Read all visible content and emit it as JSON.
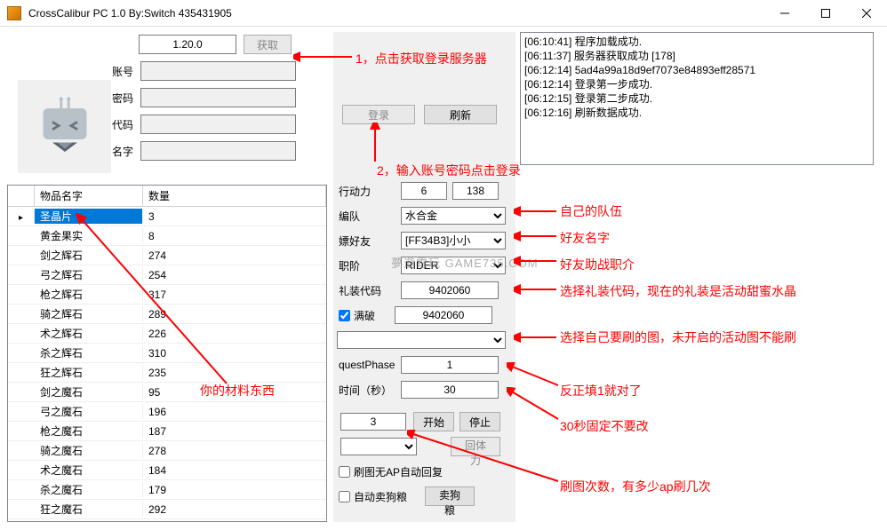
{
  "window": {
    "title": "CrossCalibur PC 1.0 By:Switch 435431905"
  },
  "top": {
    "version": "1.20.0",
    "fetch_btn": "获取",
    "account_lbl": "账号",
    "password_lbl": "密码",
    "code_lbl": "代码",
    "name_lbl": "名字",
    "login_btn": "登录",
    "refresh_btn": "刷新"
  },
  "grid": {
    "col_name": "物品名字",
    "col_qty": "数量",
    "rows": [
      {
        "name": "圣晶片",
        "qty": "3"
      },
      {
        "name": "黄金果实",
        "qty": "8"
      },
      {
        "name": "剑之辉石",
        "qty": "274"
      },
      {
        "name": "弓之辉石",
        "qty": "254"
      },
      {
        "name": "枪之辉石",
        "qty": "317"
      },
      {
        "name": "骑之辉石",
        "qty": "289"
      },
      {
        "name": "术之辉石",
        "qty": "226"
      },
      {
        "name": "杀之辉石",
        "qty": "310"
      },
      {
        "name": "狂之辉石",
        "qty": "235"
      },
      {
        "name": "剑之魔石",
        "qty": "95"
      },
      {
        "name": "弓之魔石",
        "qty": "196"
      },
      {
        "name": "枪之魔石",
        "qty": "187"
      },
      {
        "name": "骑之魔石",
        "qty": "278"
      },
      {
        "name": "术之魔石",
        "qty": "184"
      },
      {
        "name": "杀之魔石",
        "qty": "179"
      },
      {
        "name": "狂之魔石",
        "qty": "292"
      }
    ]
  },
  "mid": {
    "action_lbl": "行动力",
    "action_v1": "6",
    "action_v2": "138",
    "team_lbl": "编队",
    "team_val": "水合金",
    "friend_lbl": "嫖好友",
    "friend_val": "[FF34B3]小小",
    "class_lbl": "职阶",
    "class_val": "RIDER",
    "ce_lbl": "礼装代码",
    "ce_val": "9402060",
    "mlb_lbl": "满破",
    "mlb_val": "9402060",
    "phase_lbl": "questPhase",
    "phase_val": "1",
    "time_lbl": "时间（秒）",
    "time_val": "30",
    "count_val": "3",
    "start_btn": "开始",
    "stop_btn": "停止",
    "recover_btn": "回体力",
    "auto_ap_lbl": "刷图无AP自动回复",
    "auto_sell_lbl": "自动卖狗粮",
    "sell_btn": "卖狗粮"
  },
  "log": [
    "[06:10:41] 程序加载成功.",
    "[06:11:37] 服务器获取成功 [178]",
    "[06:12:14] 5ad4a99a18d9ef7073e84893eff28571",
    "[06:12:14] 登录第一步成功.",
    "[06:12:15] 登录第二步成功.",
    "[06:12:16] 刷新数据成功."
  ],
  "annotations": {
    "a1": "1，点击获取登录服务器",
    "a2": "2，输入账号密码点击登录",
    "a3": "你的材料东西",
    "b1": "自己的队伍",
    "b2": "好友名字",
    "b3": "好友助战职介",
    "b4": "选择礼装代码，现在的礼装是活动甜蜜水晶",
    "b5": "选择自己要刷的图，未开启的活动图不能刷",
    "b6": "反正填1就对了",
    "b7": "30秒固定不要改",
    "b8": "刷图次数，有多少ap刷几次"
  },
  "watermark": "夢遊電玩 GAME735.COM"
}
